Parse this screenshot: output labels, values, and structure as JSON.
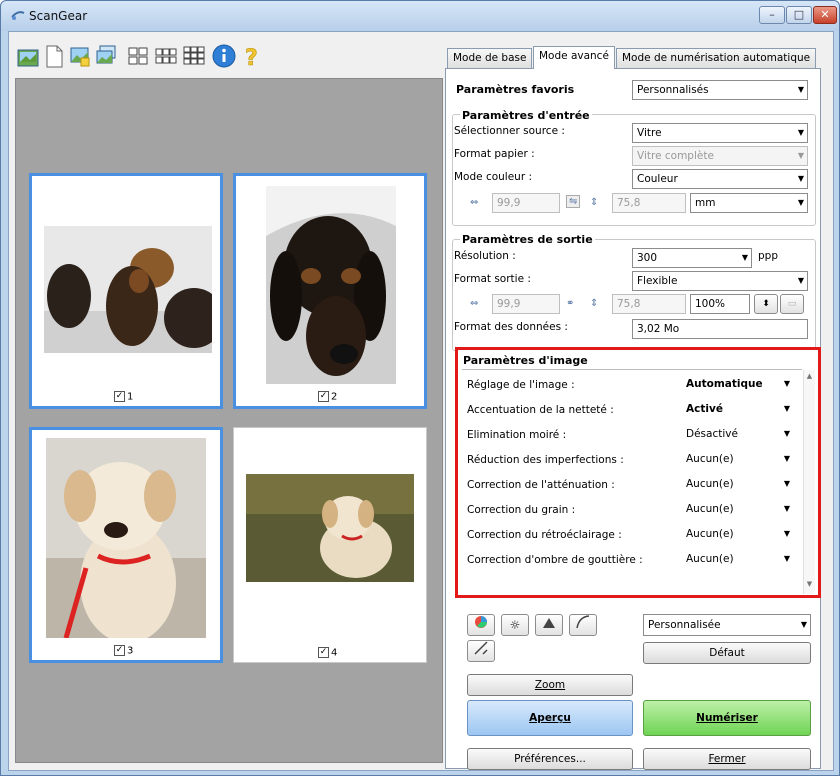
{
  "window": {
    "title": "ScanGear",
    "controls": {
      "minimize": "–",
      "maximize": "□",
      "close": "✕"
    }
  },
  "toolbar": {
    "icons": [
      "scan-icon",
      "blank-page-icon",
      "image-icon",
      "multi-image-icon",
      "thumbnails-4-icon",
      "thumbnails-6-icon",
      "thumbnails-9-icon",
      "info-icon",
      "help-icon"
    ]
  },
  "thumbnails": [
    {
      "label": "1",
      "checked": true,
      "selected": true
    },
    {
      "label": "2",
      "checked": true,
      "selected": true
    },
    {
      "label": "3",
      "checked": true,
      "selected": true
    },
    {
      "label": "4",
      "checked": true,
      "selected": false
    }
  ],
  "tabs": [
    "Mode de base",
    "Mode avancé",
    "Mode de numérisation automatique"
  ],
  "favorites": {
    "label": "Paramètres favoris",
    "value": "Personnalisés"
  },
  "input_settings": {
    "title": "Paramètres d'entrée",
    "source": {
      "label": "Sélectionner source :",
      "value": "Vitre"
    },
    "paper": {
      "label": "Format papier :",
      "value": "Vitre complète"
    },
    "color_mode": {
      "label": "Mode couleur :",
      "value": "Couleur"
    },
    "width": "99,9",
    "height": "75,8",
    "unit": "mm"
  },
  "output_settings": {
    "title": "Paramètres de sortie",
    "resolution": {
      "label": "Résolution :",
      "value": "300",
      "unit": "ppp"
    },
    "output_size": {
      "label": "Format sortie :",
      "value": "Flexible"
    },
    "width": "99,9",
    "height": "75,8",
    "scale": "100%",
    "data_size": {
      "label": "Format des données :",
      "value": "3,02 Mo"
    }
  },
  "image_settings": {
    "title": "Paramètres d'image",
    "rows": [
      {
        "label": "Réglage de l'image :",
        "value": "Automatique",
        "bold": true
      },
      {
        "label": "Accentuation de la netteté :",
        "value": "Activé",
        "bold": true
      },
      {
        "label": "Elimination moiré :",
        "value": "Désactivé",
        "bold": false
      },
      {
        "label": "Réduction des imperfections :",
        "value": "Aucun(e)",
        "bold": false
      },
      {
        "label": "Correction de l'atténuation :",
        "value": "Aucun(e)",
        "bold": false
      },
      {
        "label": "Correction du grain :",
        "value": "Aucun(e)",
        "bold": false
      },
      {
        "label": "Correction du rétroéclairage :",
        "value": "Aucun(e)",
        "bold": false
      },
      {
        "label": "Correction d'ombre de gouttière :",
        "value": "Aucun(e)",
        "bold": false
      }
    ]
  },
  "tone": {
    "preset": "Personnalisée",
    "default_label": "Défaut"
  },
  "buttons": {
    "zoom": "Zoom",
    "preview": "Aperçu",
    "scan": "Numériser",
    "preferences": "Préférences...",
    "close": "Fermer"
  }
}
